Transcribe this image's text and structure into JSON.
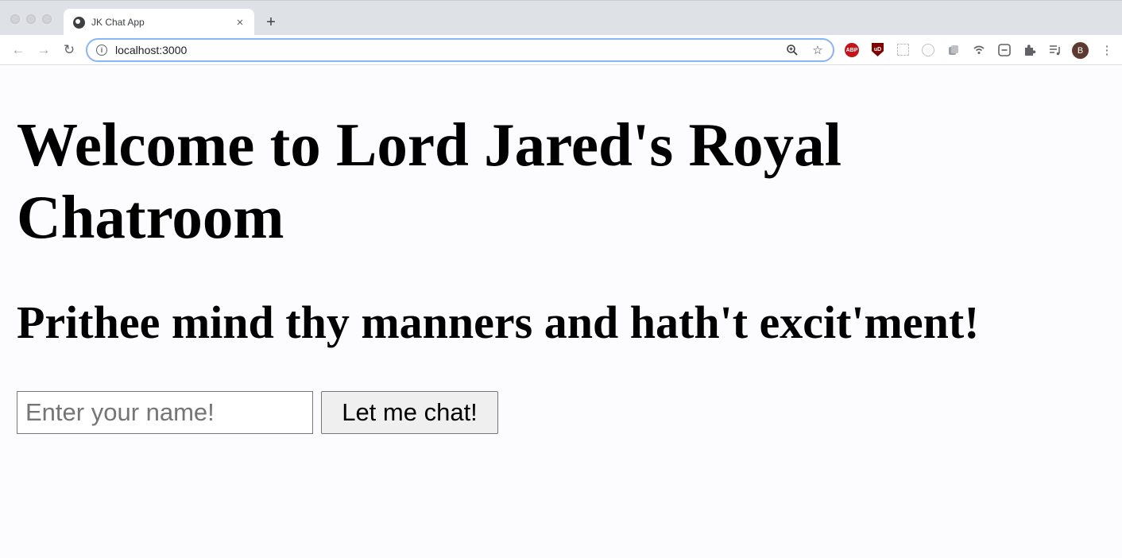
{
  "browser": {
    "tab_title": "JK Chat App",
    "tab_close": "×",
    "new_tab": "+",
    "url": "localhost:3000",
    "avatar_letter": "B",
    "extensions": {
      "abp_label": "ABP",
      "ublock_label": "uD"
    }
  },
  "page": {
    "title": "Welcome to Lord Jared's Royal Chatroom",
    "subtitle": "Prithee mind thy manners and hath't excit'ment!",
    "name_input": {
      "value": "",
      "placeholder": "Enter your name!"
    },
    "submit_label": "Let me chat!"
  },
  "colors": {
    "page_background": "#fcfcfe",
    "omnibox_focus": "#8ab4f8",
    "avatar": "#5d3a30"
  }
}
